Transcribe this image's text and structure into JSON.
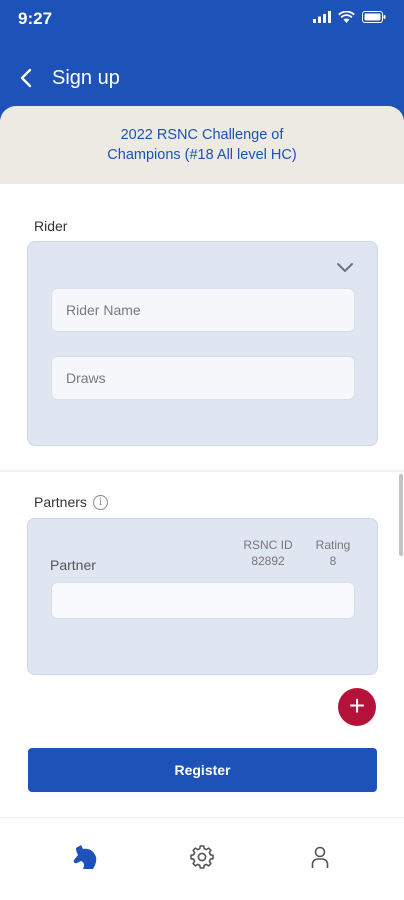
{
  "status_bar": {
    "time": "9:27"
  },
  "header": {
    "title": "Sign up"
  },
  "event": {
    "title": "2022 RSNC Challenge of Champions (#18 All level HC)"
  },
  "rider": {
    "section_label": "Rider",
    "name_placeholder": "Rider Name",
    "draws_placeholder": "Draws"
  },
  "partners": {
    "section_label": "Partners",
    "info_glyph": "i",
    "partner_label": "Partner",
    "rsnc_id_header": "RSNC ID",
    "rsnc_id_value": "82892",
    "rating_header": "Rating",
    "rating_value": "8"
  },
  "actions": {
    "add_glyph": "+",
    "register_label": "Register"
  },
  "icons": [
    "back-arrow-icon",
    "chevron-down-icon",
    "info-icon",
    "plus-icon",
    "horse-icon",
    "gear-icon",
    "person-icon"
  ],
  "colors": {
    "primary": "#1d52b8",
    "accent": "#b5123a",
    "card": "#e0e6f1",
    "event_bg": "#eceae3"
  }
}
